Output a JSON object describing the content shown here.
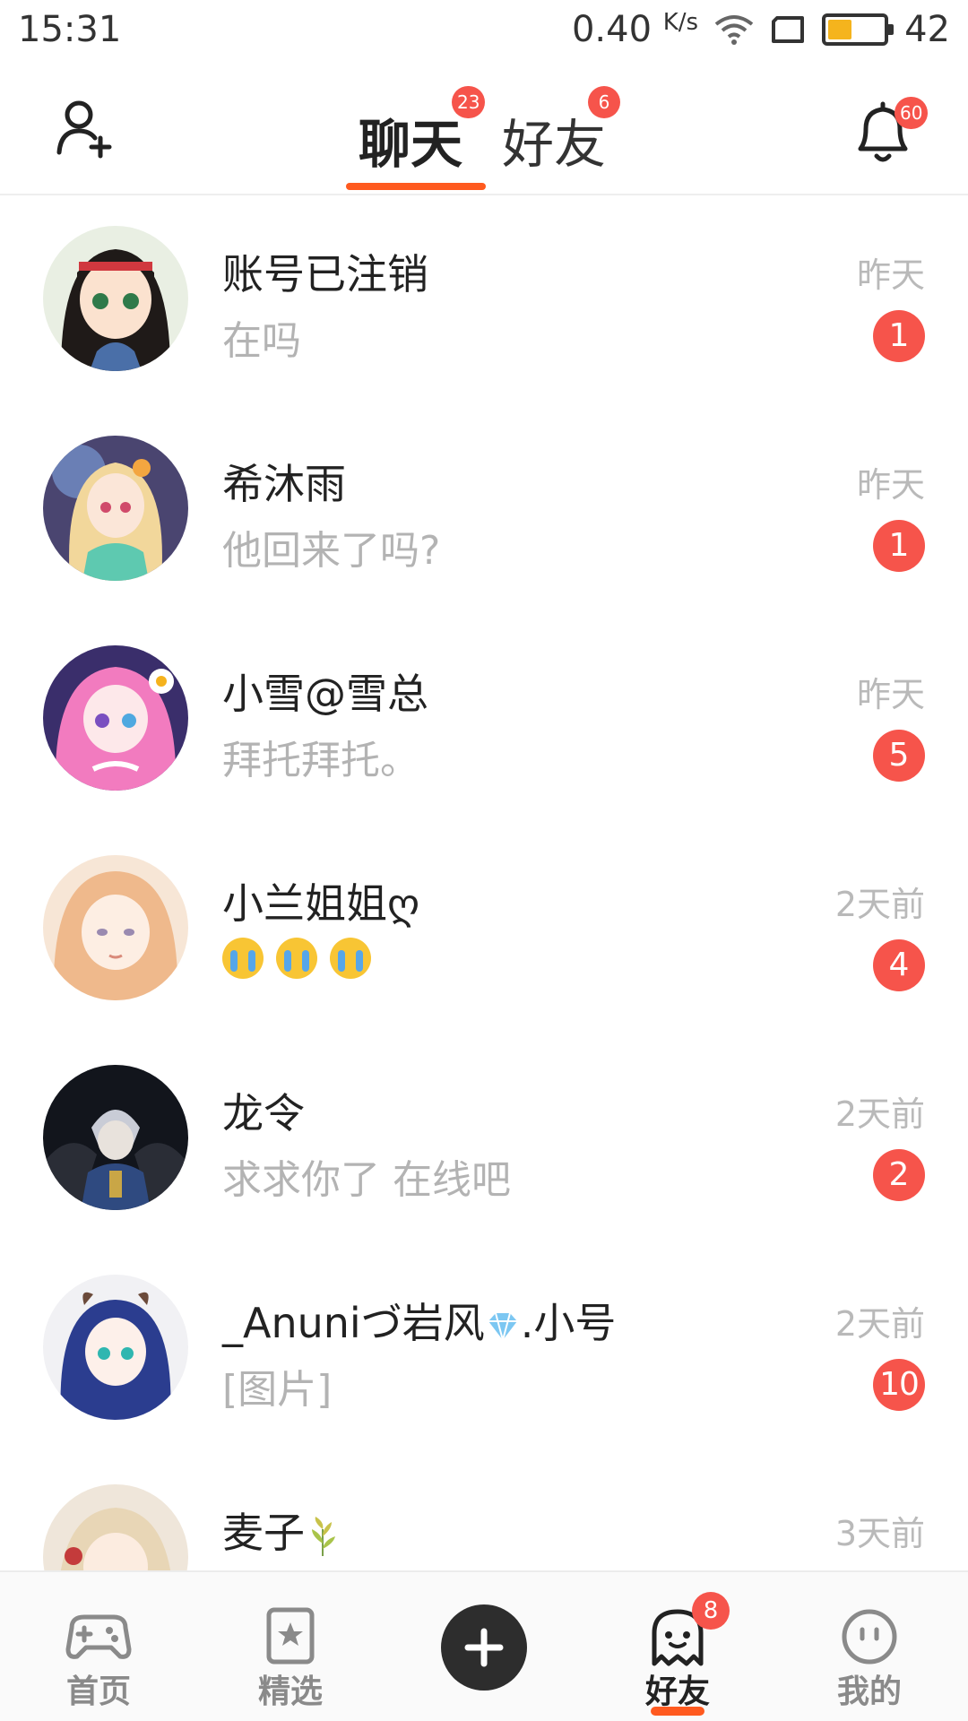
{
  "status_bar": {
    "time": "15:31",
    "speed": "0.40",
    "speed_unit": "K/s",
    "battery": "42",
    "battery_level": 0.4
  },
  "header": {
    "tabs": [
      {
        "label": "聊天",
        "badge": "23",
        "active": true
      },
      {
        "label": "好友",
        "badge": "6",
        "active": false
      }
    ],
    "notification_badge": "60",
    "accent_color": "#ff5a1f",
    "badge_color": "#f6544b"
  },
  "chats": [
    {
      "name": "账号已注销",
      "preview": "在吗",
      "time": "昨天",
      "unread": "1"
    },
    {
      "name": "希沐雨",
      "preview": "他回来了吗?",
      "time": "昨天",
      "unread": "1"
    },
    {
      "name": "小雪@雪总",
      "preview": "拜托拜托。",
      "time": "昨天",
      "unread": "5"
    },
    {
      "name": "小兰姐姐ღ",
      "preview": "",
      "preview_icons": [
        "crying-emoji-icon",
        "crying-emoji-icon",
        "crying-emoji-icon"
      ],
      "time": "2天前",
      "unread": "4"
    },
    {
      "name": "龙令",
      "preview": "求求你了 在线吧",
      "time": "2天前",
      "unread": "2"
    },
    {
      "name_prefix": "_Anuniづ岩风",
      "name_icon": "diamond-icon",
      "name_suffix": ".小号",
      "preview": "[图片]",
      "time": "2天前",
      "unread": "10"
    },
    {
      "name": "麦子",
      "name_icon": "wheat-icon",
      "preview": "",
      "time": "3天前",
      "unread": ""
    }
  ],
  "bottom_nav": {
    "items": [
      {
        "label": "首页",
        "icon": "gamepad-icon"
      },
      {
        "label": "精选",
        "icon": "star-bookmark-icon"
      },
      {
        "label": "",
        "icon": "plus-icon"
      },
      {
        "label": "好友",
        "icon": "ghost-icon",
        "badge": "8",
        "active": true
      },
      {
        "label": "我的",
        "icon": "face-icon"
      }
    ]
  }
}
